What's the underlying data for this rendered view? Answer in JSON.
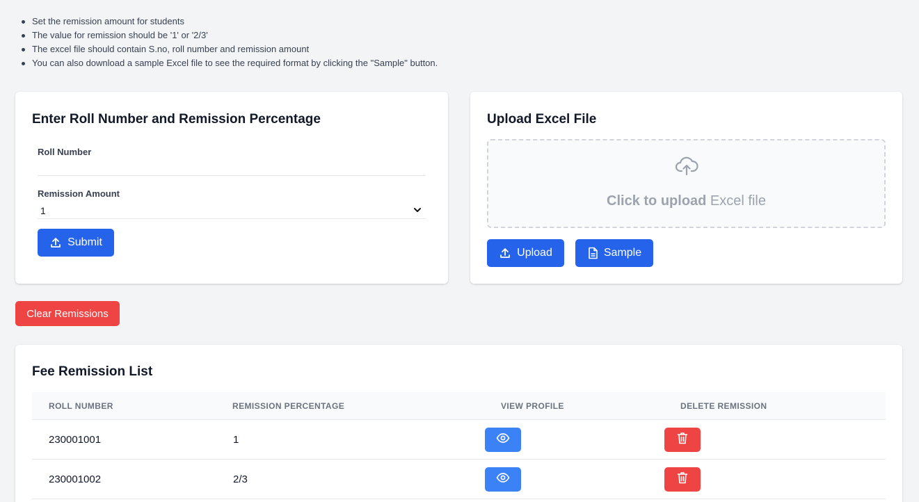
{
  "instructions": [
    "Set the remission amount for students",
    "The value for remission should be '1' or '2/3'",
    "The excel file should contain S.no, roll number and remission amount",
    "You can also download a sample Excel file to see the required format by clicking the \"Sample\" button."
  ],
  "manual_form": {
    "title": "Enter Roll Number and Remission Percentage",
    "roll_label": "Roll Number",
    "roll_value": "",
    "roll_placeholder": "",
    "remission_label": "Remission Amount",
    "remission_selected": "1",
    "submit_label": "Submit"
  },
  "upload_card": {
    "title": "Upload Excel File",
    "dropzone_bold": "Click to upload",
    "dropzone_rest": " Excel file",
    "upload_label": "Upload",
    "sample_label": "Sample"
  },
  "clear_label": "Clear Remissions",
  "list": {
    "title": "Fee Remission List",
    "columns": [
      "ROLL NUMBER",
      "REMISSION PERCENTAGE",
      "VIEW PROFILE",
      "DELETE REMISSION"
    ],
    "rows": [
      {
        "roll": "230001001",
        "percentage": "1"
      },
      {
        "roll": "230001002",
        "percentage": "2/3"
      }
    ]
  },
  "icons": {
    "submit": "upload-icon",
    "upload": "upload-icon",
    "sample": "document-icon",
    "dropzone": "cloud-upload-icon",
    "view": "eye-icon",
    "delete": "trash-icon",
    "select": "chevron-down-icon"
  },
  "colors": {
    "primary": "#2563eb",
    "view": "#3b82f6",
    "danger": "#ef4444",
    "background": "#f3f4f6"
  }
}
